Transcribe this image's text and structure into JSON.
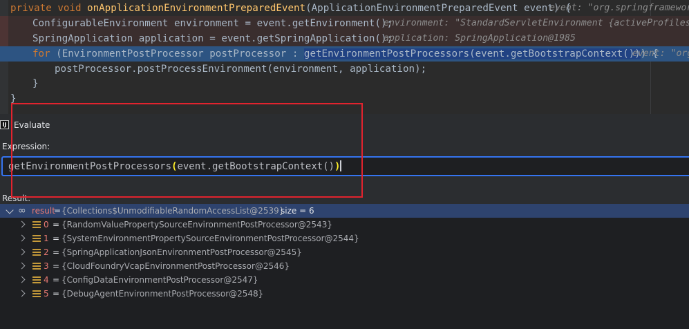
{
  "editor": {
    "lines": [
      {
        "kw1": "private void ",
        "method": "onApplicationEnvironmentPreparedEvent",
        "rest": "(ApplicationEnvironmentPreparedEvent event) {",
        "hint": "event: \"org.springframework.boot.context.event.ApplicationEnvironmentPreparedEvent\""
      },
      {
        "code": "ConfigurableEnvironment environment = event.getEnvironment();",
        "hint": "environment: \"StandardServletEnvironment {activeProfiles=[], defaultProfiles=[default]}\""
      },
      {
        "code": "SpringApplication application = event.getSpringApplication();",
        "hint": "application: SpringApplication@1985"
      },
      {
        "kw": "for",
        "mid": " (EnvironmentPostProcessor postProcessor : ",
        "selected": "getEnvironmentPostProcessors(event.getBootstrapContext())",
        "end": ") {",
        "hint": "event: \"org.springframework.boot.context.event.ApplicationEnvironmentPreparedEvent\""
      },
      {
        "code": "postProcessor.postProcessEnvironment(environment, application);"
      },
      {
        "code": "}"
      },
      {
        "code": "}"
      }
    ]
  },
  "evaluate": {
    "title": "Evaluate",
    "icon": "intellij-icon",
    "icon_text": "IJ",
    "expression_label": "Expression:",
    "expression_main": "getEnvironmentPostProcessors",
    "expression_paren_open": "(",
    "expression_inner": "event.getBootstrapContext()",
    "expression_paren_close": ")",
    "result_label": "Result:"
  },
  "result": {
    "name": "result",
    "equals": " = ",
    "value": "{Collections$UnmodifiableRandomAccessList@2539}",
    "size": "size = 6",
    "items": [
      {
        "index": "0",
        "value": "{RandomValuePropertySourceEnvironmentPostProcessor@2543}"
      },
      {
        "index": "1",
        "value": "{SystemEnvironmentPropertySourceEnvironmentPostProcessor@2544}"
      },
      {
        "index": "2",
        "value": "{SpringApplicationJsonEnvironmentPostProcessor@2545}"
      },
      {
        "index": "3",
        "value": "{CloudFoundryVcapEnvironmentPostProcessor@2546}"
      },
      {
        "index": "4",
        "value": "{ConfigDataEnvironmentPostProcessor@2547}"
      },
      {
        "index": "5",
        "value": "{DebugAgentEnvironmentPostProcessor@2548}"
      }
    ],
    "item_equals": "="
  },
  "colors": {
    "highlight_box": "#e2232e",
    "keyword": "#cc7832",
    "method": "#ffc66d",
    "selection": "#214283",
    "current_line": "#2d5482",
    "variable_name": "#e87a73"
  }
}
